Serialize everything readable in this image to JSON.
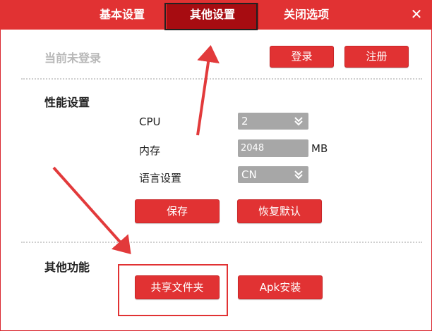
{
  "tabs": {
    "basic": "基本设置",
    "other": "其他设置",
    "close_options": "关闭选项",
    "close_glyph": "✕"
  },
  "account": {
    "status": "当前未登录",
    "login_label": "登录",
    "register_label": "注册"
  },
  "performance": {
    "title": "性能设置",
    "cpu_label": "CPU",
    "cpu_value": "2",
    "memory_label": "内存",
    "memory_value": "2048",
    "memory_unit": "MB",
    "language_label": "语言设置",
    "language_value": "CN",
    "save_label": "保存",
    "reset_label": "恢复默认"
  },
  "other_functions": {
    "title": "其他功能",
    "share_folder_label": "共享文件夹",
    "apk_install_label": "Apk安装"
  },
  "colors": {
    "brand_red": "#e13233",
    "active_tab": "#a70c11",
    "select_gray": "#a7a7a7"
  }
}
